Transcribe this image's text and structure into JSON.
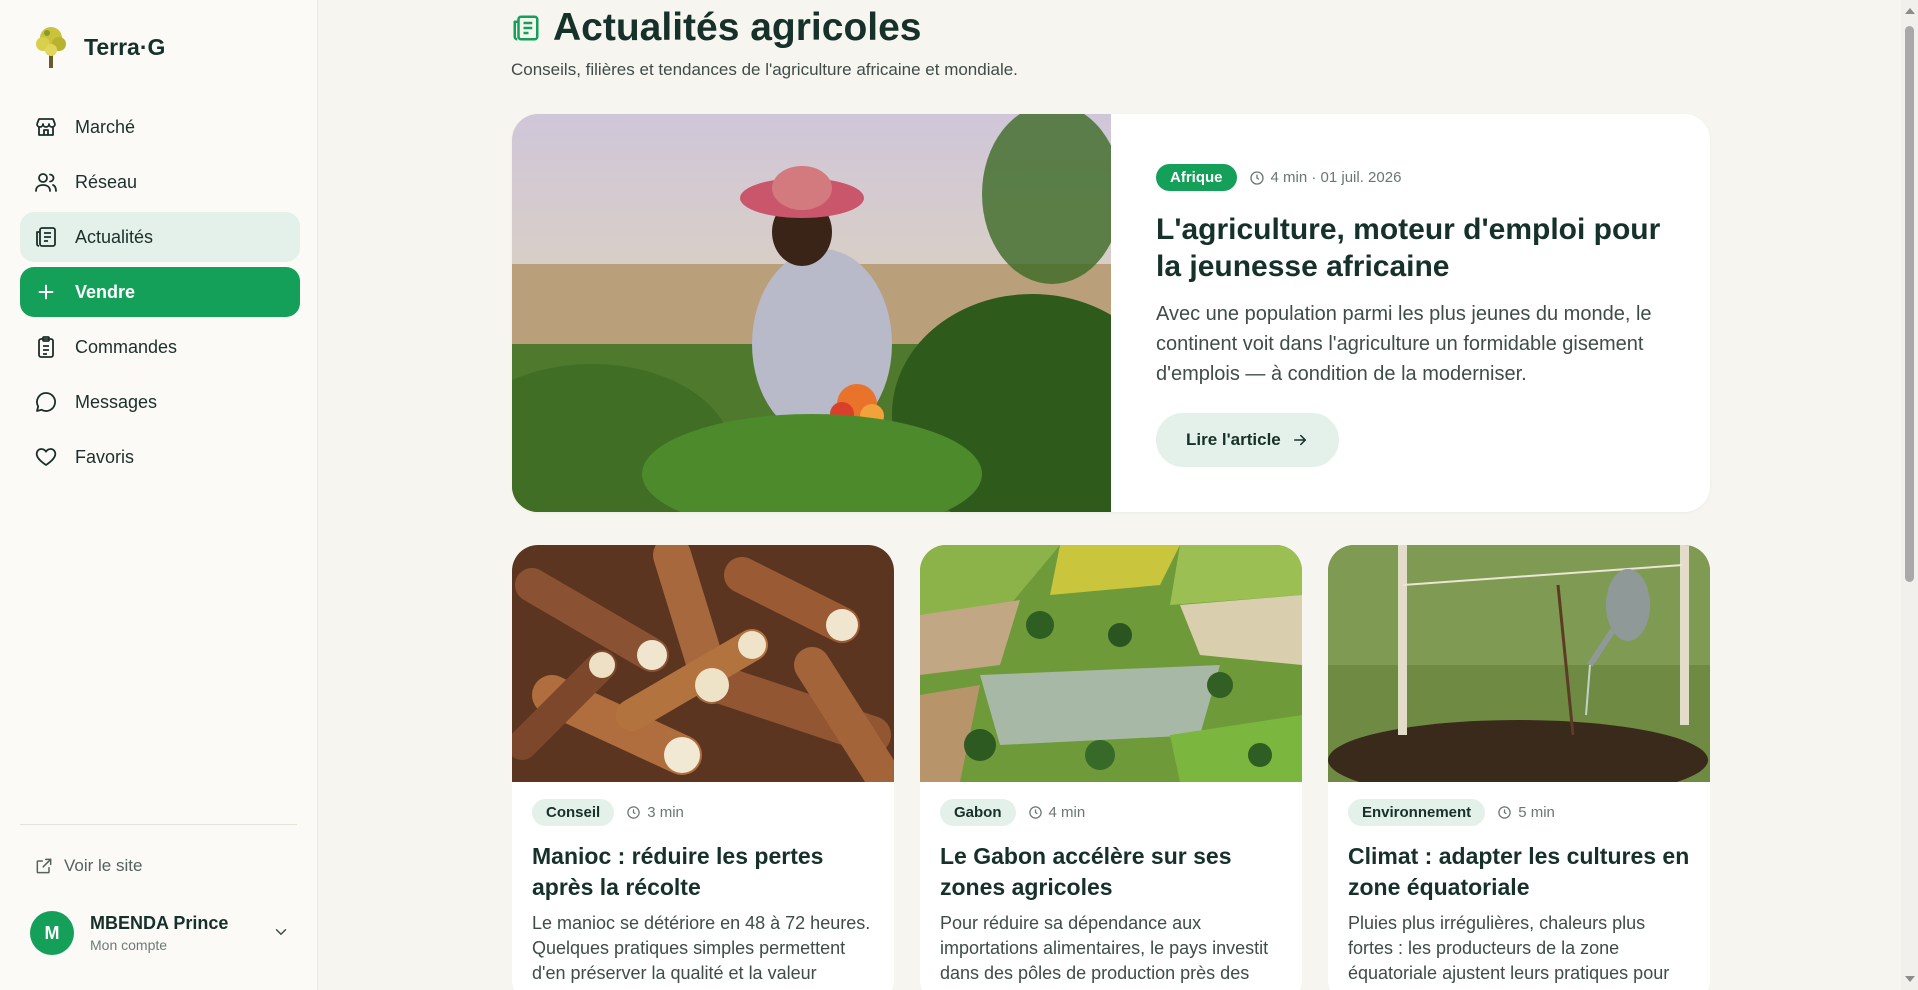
{
  "brand": {
    "name": "Terra·G"
  },
  "sidebar": {
    "items": [
      {
        "label": "Marché",
        "icon": "store-icon"
      },
      {
        "label": "Réseau",
        "icon": "users-icon"
      },
      {
        "label": "Actualités",
        "icon": "newspaper-icon",
        "active": true
      },
      {
        "label": "Vendre",
        "icon": "plus-icon",
        "primary": true
      },
      {
        "label": "Commandes",
        "icon": "clipboard-icon"
      },
      {
        "label": "Messages",
        "icon": "message-icon"
      },
      {
        "label": "Favoris",
        "icon": "heart-icon"
      }
    ],
    "visit_site": "Voir le site",
    "account": {
      "initial": "M",
      "name": "MBENDA Prince",
      "subtitle": "Mon compte"
    }
  },
  "page": {
    "title": "Actualités agricoles",
    "subtitle": "Conseils, filières et tendances de l'agriculture africaine et mondiale."
  },
  "featured": {
    "tag": "Afrique",
    "meta": "4 min · 01 juil. 2026",
    "title": "L'agriculture, moteur d'emploi pour la jeunesse africaine",
    "excerpt": "Avec une population parmi les plus jeunes du monde, le continent voit dans l'agriculture un formidable gisement d'emplois — à condition de la moderniser.",
    "cta": "Lire l'article"
  },
  "articles": [
    {
      "tag": "Conseil",
      "time": "3 min",
      "title": "Manioc : réduire les pertes après la récolte",
      "excerpt": "Le manioc se détériore en 48 à 72 heures. Quelques pratiques simples permettent d'en préserver la qualité et la valeur"
    },
    {
      "tag": "Gabon",
      "time": "4 min",
      "title": "Le Gabon accélère sur ses zones agricoles",
      "excerpt": "Pour réduire sa dépendance aux importations alimentaires, le pays investit dans des pôles de production près des"
    },
    {
      "tag": "Environnement",
      "time": "5 min",
      "title": "Climat : adapter les cultures en zone équatoriale",
      "excerpt": "Pluies plus irrégulières, chaleurs plus fortes : les producteurs de la zone équatoriale ajustent leurs pratiques pour"
    }
  ],
  "colors": {
    "accent": "#15a05a",
    "accent_soft": "#e4f1ea",
    "text": "#16302a",
    "background": "#f6f5f0"
  }
}
